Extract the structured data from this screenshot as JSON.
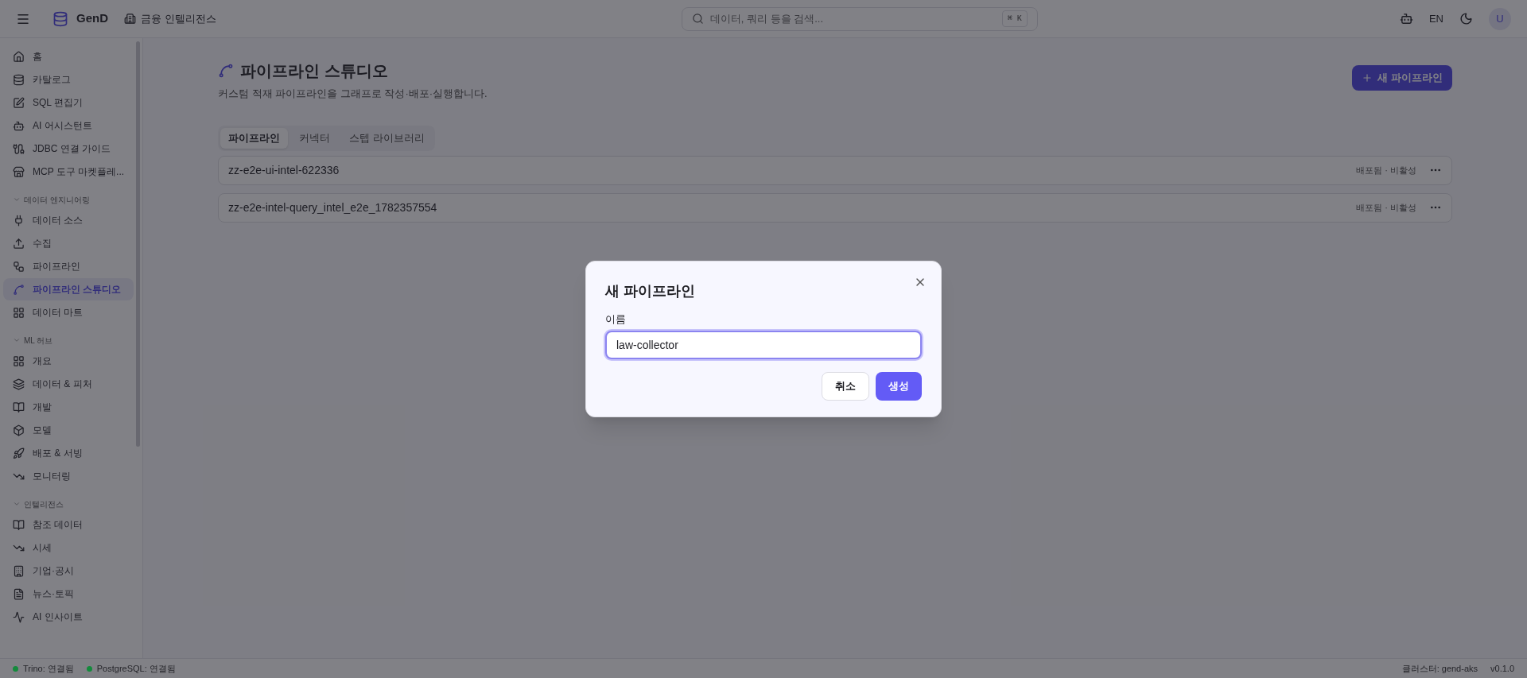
{
  "header": {
    "brand": "GenD",
    "workspace": "금융 인텔리전스",
    "search_placeholder": "데이터, 쿼리 등을 검색...",
    "shortcut": "⌘ K",
    "language": "EN",
    "avatar": "U"
  },
  "sidebar": {
    "groups": [
      {
        "items": [
          {
            "label": "홈",
            "selected": false
          },
          {
            "label": "카탈로그",
            "selected": false
          },
          {
            "label": "SQL 편집기",
            "selected": false
          },
          {
            "label": "AI 어시스턴트",
            "selected": false
          },
          {
            "label": "JDBC 연결 가이드",
            "selected": false
          },
          {
            "label": "MCP 도구 마켓플레...",
            "selected": false
          }
        ]
      },
      {
        "title": "데이터 엔지니어링",
        "expanded": true,
        "items": [
          {
            "label": "데이터 소스",
            "selected": false
          },
          {
            "label": "수집",
            "selected": false
          },
          {
            "label": "파이프라인",
            "selected": false
          },
          {
            "label": "파이프라인 스튜디오",
            "selected": true
          },
          {
            "label": "데이터 마트",
            "selected": false
          }
        ]
      },
      {
        "title": "ML 허브",
        "expanded": true,
        "items": [
          {
            "label": "개요",
            "selected": false
          },
          {
            "label": "데이터 & 피처",
            "selected": false
          },
          {
            "label": "개발",
            "selected": false
          },
          {
            "label": "모델",
            "selected": false
          },
          {
            "label": "배포 & 서빙",
            "selected": false
          },
          {
            "label": "모니터링",
            "selected": false
          }
        ]
      },
      {
        "title": "인텔리전스",
        "expanded": true,
        "items": [
          {
            "label": "참조 데이터",
            "selected": false
          },
          {
            "label": "시세",
            "selected": false
          },
          {
            "label": "기업·공시",
            "selected": false
          },
          {
            "label": "뉴스·토픽",
            "selected": false
          },
          {
            "label": "AI 인사이트",
            "selected": false
          }
        ]
      }
    ]
  },
  "page": {
    "title": "파이프라인 스튜디오",
    "subtitle": "커스텀 적재 파이프라인을 그래프로 작성·배포·실행합니다.",
    "new_button": "새 파이프라인",
    "tabs": [
      {
        "label": "파이프라인",
        "selected": true
      },
      {
        "label": "커넥터",
        "selected": false
      },
      {
        "label": "스텝 라이브러리",
        "selected": false
      }
    ],
    "pipelines": [
      {
        "name": "zz-e2e-ui-intel-622336",
        "status": "배포됨 · 비활성"
      },
      {
        "name": "zz-e2e-intel-query_intel_e2e_1782357554",
        "status": "배포됨 · 비활성"
      }
    ]
  },
  "dialog": {
    "title": "새 파이프라인",
    "field_label": "이름",
    "field_value": "law-collector",
    "cancel": "취소",
    "create": "생성"
  },
  "status_bar": {
    "connections": [
      {
        "label": "Trino: 연결됨",
        "color": "#148a3c"
      },
      {
        "label": "PostgreSQL: 연결됨",
        "color": "#148a3c"
      }
    ],
    "cluster": "클러스터: gend-aks",
    "version": "v0.1.0"
  }
}
